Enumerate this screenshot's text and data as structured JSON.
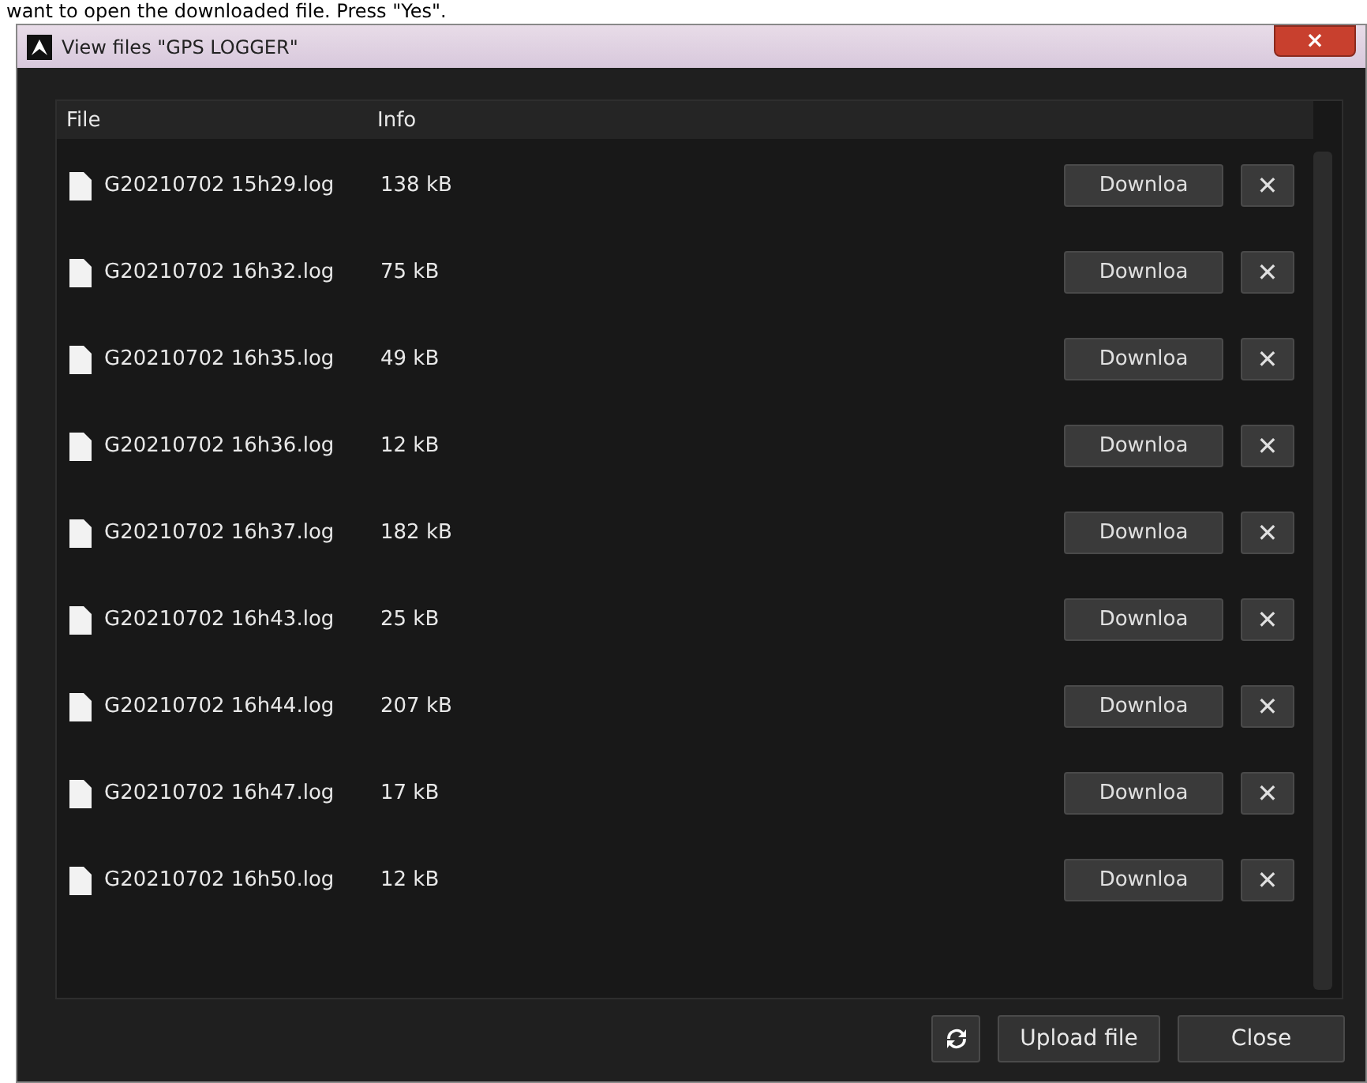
{
  "caption": "want to open the downloaded file. Press \"Yes\".",
  "window": {
    "title": "View files \"GPS LOGGER\"",
    "close": "×"
  },
  "table": {
    "columns": [
      "File",
      "Info"
    ],
    "rows": [
      {
        "file": "G20210702 15h29.log",
        "info": "138 kB",
        "download": "Downloa",
        "delete": "✕"
      },
      {
        "file": "G20210702 16h32.log",
        "info": "75 kB",
        "download": "Downloa",
        "delete": "✕"
      },
      {
        "file": "G20210702 16h35.log",
        "info": "49 kB",
        "download": "Downloa",
        "delete": "✕"
      },
      {
        "file": "G20210702 16h36.log",
        "info": "12 kB",
        "download": "Downloa",
        "delete": "✕"
      },
      {
        "file": "G20210702 16h37.log",
        "info": "182 kB",
        "download": "Downloa",
        "delete": "✕"
      },
      {
        "file": "G20210702 16h43.log",
        "info": "25 kB",
        "download": "Downloa",
        "delete": "✕"
      },
      {
        "file": "G20210702 16h44.log",
        "info": "207 kB",
        "download": "Downloa",
        "delete": "✕"
      },
      {
        "file": "G20210702 16h47.log",
        "info": "17 kB",
        "download": "Downloa",
        "delete": "✕"
      },
      {
        "file": "G20210702 16h50.log",
        "info": "12 kB",
        "download": "Downloa",
        "delete": "✕"
      }
    ]
  },
  "buttons": [
    "Upload file",
    "Close"
  ]
}
